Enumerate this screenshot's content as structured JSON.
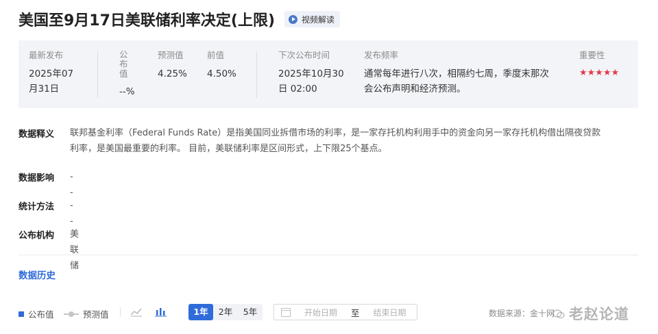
{
  "header": {
    "title": "美国至9月17日美联储利率决定(上限)",
    "video_label": "视频解读"
  },
  "info": {
    "latest_label": "最新发布",
    "latest_value_line1": "2025年07",
    "latest_value_line2": "月31日",
    "published_label_line1": "公",
    "published_label_line2": "布",
    "published_label_line3": "值",
    "published_value": "--%",
    "forecast_label": "预测值",
    "forecast_value": "4.25%",
    "previous_label": "前值",
    "previous_value": "4.50%",
    "next_label": "下次公布时间",
    "next_value_line1": "2025年10月30",
    "next_value_line2": "日 02:00",
    "frequency_label": "发布频率",
    "frequency_value_line1": "通常每年进行八次，相隔约七周，季度末那次",
    "frequency_value_line2": "会公布声明和经济预测。",
    "importance_label": "重要性",
    "importance_stars": "★★★★★",
    "importance_level": 5,
    "star_color": "#e03c48"
  },
  "details": {
    "definition_label": "数据释义",
    "definition_line1": "联邦基金利率（Federal Funds Rate）是指美国同业拆借市场的利率，是一家存托机构利用手中的资金向另一家存托机构借出隔夜贷款",
    "definition_line2": "利率，是美国最重要的利率。 目前，美联储利率是区间形式，上下限25个基点。",
    "impact_label": "数据影响",
    "impact_value": "--",
    "method_label": "统计方法",
    "method_value": "--",
    "agency_label": "公布机构",
    "agency_value": "美联储"
  },
  "history": {
    "title": "数据历史",
    "legend_published": "公布值",
    "legend_forecast": "预测值",
    "line_icon": "line-chart-icon",
    "bar_icon": "bar-chart-icon",
    "years": [
      "1年",
      "2年",
      "5年"
    ],
    "active_year": "1年",
    "start_placeholder": "开始日期",
    "range_sep": "至",
    "end_placeholder": "结束日期",
    "source": "数据来源：金十网",
    "accent": "#2f6bd9"
  },
  "watermark": "老赵论道"
}
